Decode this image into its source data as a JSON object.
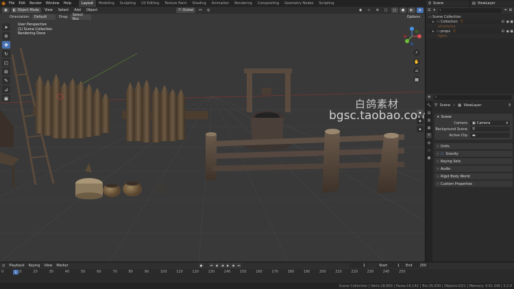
{
  "topbar": {
    "menus": [
      "File",
      "Edit",
      "Render",
      "Window",
      "Help"
    ],
    "workspaces": [
      "Layout",
      "Modeling",
      "Sculpting",
      "UV Editing",
      "Texture Paint",
      "Shading",
      "Animation",
      "Rendering",
      "Compositing",
      "Geometry Nodes",
      "Scripting"
    ],
    "active_workspace": "Layout",
    "scene": "Scene",
    "view_layer": "ViewLayer"
  },
  "viewport": {
    "mode": "Object Mode",
    "menus": [
      "View",
      "Select",
      "Add",
      "Object"
    ],
    "transform": "Global",
    "orientation_label": "Orientation:",
    "orientation_value": "Default",
    "drag_label": "Drag:",
    "drag_value": "Select Box",
    "options": "Options",
    "overlay_lines": [
      "User Perspective",
      "(1) Scene Collection",
      "Rendering Done"
    ],
    "watermark_cn": "白鸽素材",
    "watermark_url": "bgsc.taobao.com"
  },
  "outliner": {
    "title": "Scene Collection",
    "rows": [
      {
        "label": "Scene Collection",
        "indent": 0,
        "color": "#cfcfcf"
      },
      {
        "label": "Collection",
        "indent": 1,
        "color": "#d8d8d8"
      },
      {
        "label": "structures",
        "indent": 2,
        "color": "#c87c3c"
      },
      {
        "label": "props",
        "indent": 1,
        "color": "#d8d8d8"
      },
      {
        "label": "lights",
        "indent": 1,
        "color": "#c87c3c"
      }
    ]
  },
  "properties": {
    "breadcrumb_scene": "Scene",
    "breadcrumb_layer": "ViewLayer",
    "panel_title": "Scene",
    "fields": [
      {
        "label": "Camera",
        "value": "Camera"
      },
      {
        "label": "Background Scene",
        "value": ""
      },
      {
        "label": "Active Clip",
        "value": ""
      }
    ],
    "subpanels": [
      "Units",
      "Gravity",
      "Keying Sets",
      "Audio",
      "Rigid Body World",
      "Custom Properties"
    ]
  },
  "timeline": {
    "menus": [
      "Playback",
      "Keying",
      "View",
      "Marker"
    ],
    "current_frame": "1",
    "start_label": "Start",
    "start": "1",
    "end_label": "End",
    "end": "250",
    "ticks": [
      "0",
      "10",
      "20",
      "30",
      "40",
      "50",
      "60",
      "70",
      "80",
      "90",
      "100",
      "110",
      "120",
      "130",
      "140",
      "150",
      "160",
      "170",
      "180",
      "190",
      "200",
      "210",
      "220",
      "230",
      "240",
      "250"
    ]
  },
  "status": "Scene Collection | Verts:18,960 | Faces:16,142 | Tris:35,930 | Objects:0/21 | Memory: 9.61 GiB | 3.2.0",
  "colors": {
    "accent": "#4772b3",
    "orange": "#e87d0d"
  }
}
